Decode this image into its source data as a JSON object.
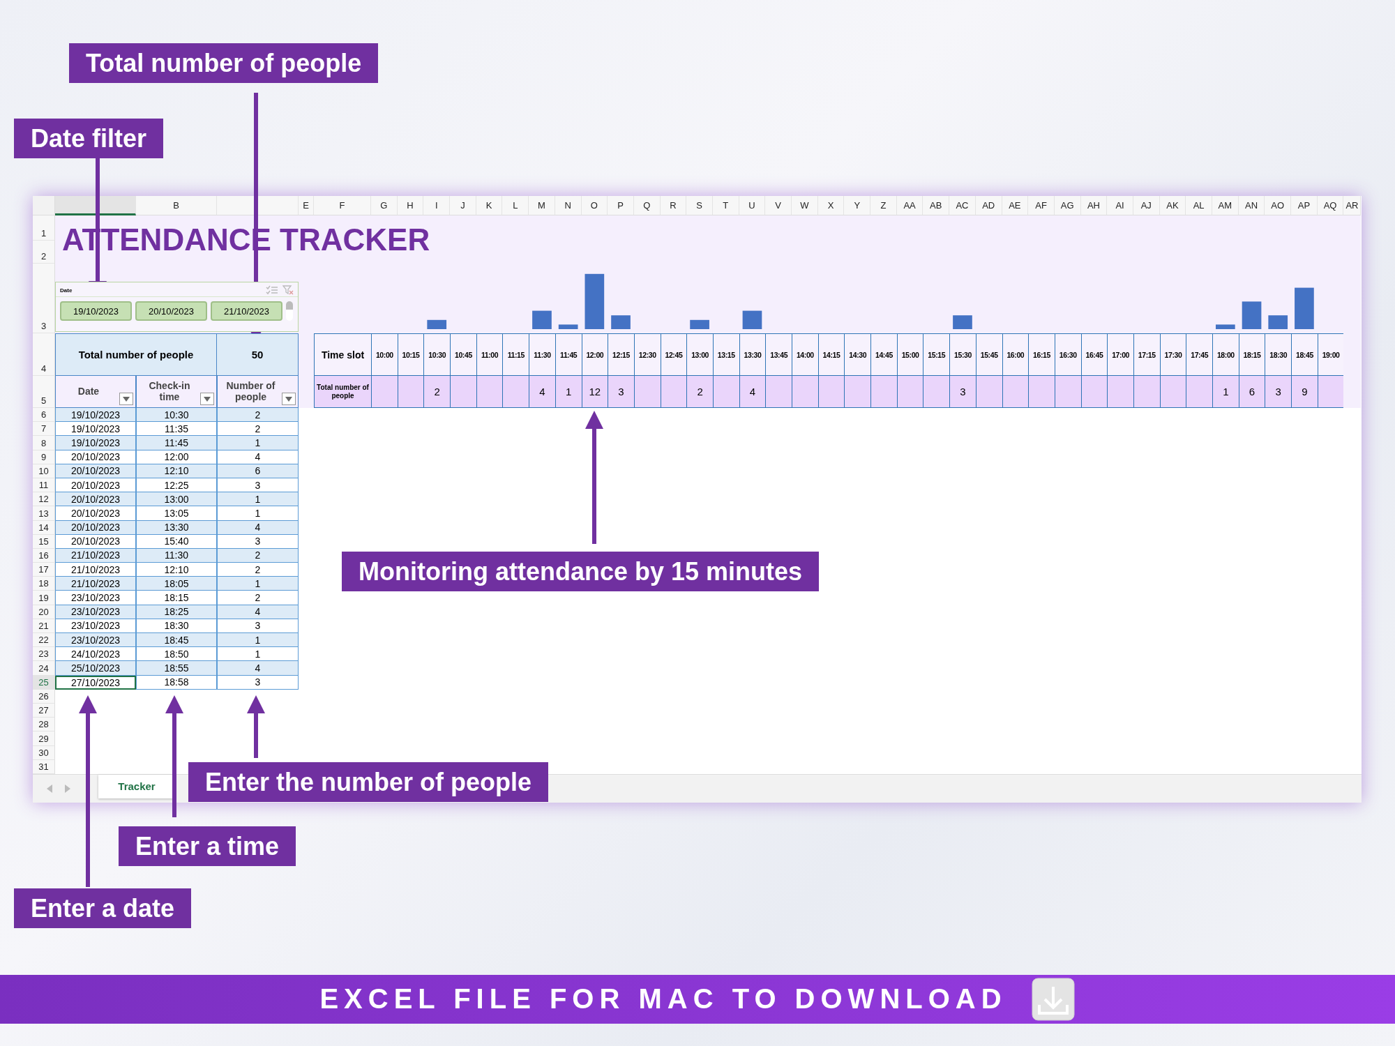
{
  "callouts": [
    {
      "text": "Total number of people"
    },
    {
      "text": "Date filter"
    },
    {
      "text": "Monitoring attendance by 15 minutes"
    },
    {
      "text": "Enter the number of people"
    },
    {
      "text": "Enter a time"
    },
    {
      "text": "Enter a date"
    }
  ],
  "spreadsheet": {
    "columns": [
      {
        "selected": true
      },
      {
        "label": "B",
        "selected": false
      },
      {
        "selected": false
      },
      {
        "label": "E",
        "selected": false
      },
      {
        "label": "F",
        "selected": false
      },
      {
        "label": "G",
        "selected": false
      },
      {
        "label": "H",
        "selected": false
      },
      {
        "label": "I",
        "selected": false
      },
      {
        "label": "J",
        "selected": false
      },
      {
        "label": "K",
        "selected": false
      },
      {
        "label": "L",
        "selected": false
      },
      {
        "label": "M",
        "selected": false
      },
      {
        "label": "N",
        "selected": false
      },
      {
        "label": "O",
        "selected": false
      },
      {
        "label": "P",
        "selected": false
      },
      {
        "label": "Q",
        "selected": false
      },
      {
        "label": "R",
        "selected": false
      },
      {
        "label": "S",
        "selected": false
      },
      {
        "label": "T",
        "selected": false
      },
      {
        "label": "U",
        "selected": false
      },
      {
        "label": "V",
        "selected": false
      },
      {
        "label": "W",
        "selected": false
      },
      {
        "label": "X",
        "selected": false
      },
      {
        "label": "Y",
        "selected": false
      },
      {
        "label": "Z",
        "selected": false
      },
      {
        "label": "AA",
        "selected": false
      },
      {
        "label": "AB",
        "selected": false
      },
      {
        "label": "AC",
        "selected": false
      },
      {
        "label": "AD",
        "selected": false
      },
      {
        "label": "AE",
        "selected": false
      },
      {
        "label": "AF",
        "selected": false
      },
      {
        "label": "AG",
        "selected": false
      },
      {
        "label": "AH",
        "selected": false
      },
      {
        "label": "AI",
        "selected": false
      },
      {
        "label": "AJ",
        "selected": false
      },
      {
        "label": "AK",
        "selected": false
      },
      {
        "label": "AL",
        "selected": false
      },
      {
        "label": "AM",
        "selected": false
      },
      {
        "label": "AN",
        "selected": false
      },
      {
        "label": "AO",
        "selected": false
      },
      {
        "label": "AP",
        "selected": false
      },
      {
        "label": "AQ",
        "selected": false
      },
      {
        "label": "AR",
        "selected": false
      }
    ],
    "row_numbers": [
      {
        "label": "1",
        "selected": false
      },
      {
        "label": "2",
        "selected": false
      },
      {
        "label": "3",
        "selected": false
      },
      {
        "label": "4",
        "selected": false
      },
      {
        "label": "5",
        "selected": false
      },
      {
        "label": "6",
        "selected": false
      },
      {
        "label": "7",
        "selected": false
      },
      {
        "label": "8",
        "selected": false
      },
      {
        "label": "9",
        "selected": false
      },
      {
        "label": "10",
        "selected": false
      },
      {
        "label": "11",
        "selected": false
      },
      {
        "label": "12",
        "selected": false
      },
      {
        "label": "13",
        "selected": false
      },
      {
        "label": "14",
        "selected": false
      },
      {
        "label": "15",
        "selected": false
      },
      {
        "label": "16",
        "selected": false
      },
      {
        "label": "17",
        "selected": false
      },
      {
        "label": "18",
        "selected": false
      },
      {
        "label": "19",
        "selected": false
      },
      {
        "label": "20",
        "selected": false
      },
      {
        "label": "21",
        "selected": false
      },
      {
        "label": "22",
        "selected": false
      },
      {
        "label": "23",
        "selected": false
      },
      {
        "label": "24",
        "selected": false
      },
      {
        "label": "25",
        "selected": true
      },
      {
        "label": "26",
        "selected": false
      },
      {
        "label": "27",
        "selected": false
      },
      {
        "label": "28",
        "selected": false
      },
      {
        "label": "29",
        "selected": false
      },
      {
        "label": "30",
        "selected": false
      },
      {
        "label": "31",
        "selected": false
      }
    ],
    "title": "ATTENDANCE TRACKER",
    "slicer": {
      "title": "Date",
      "items": [
        {
          "label": "19/10/2023",
          "selected": true
        },
        {
          "label": "20/10/2023",
          "selected": true
        },
        {
          "label": "21/10/2023",
          "selected": true
        }
      ]
    },
    "summary": {
      "label": "Total number of people",
      "value": "50"
    },
    "table": {
      "columns": [
        "Date",
        "Check-in time",
        "Number of people"
      ],
      "rows": [
        {
          "date": "19/10/2023",
          "time": "10:30",
          "people": "2",
          "selected": false
        },
        {
          "date": "19/10/2023",
          "time": "11:35",
          "people": "2",
          "selected": false
        },
        {
          "date": "19/10/2023",
          "time": "11:45",
          "people": "1",
          "selected": false
        },
        {
          "date": "20/10/2023",
          "time": "12:00",
          "people": "4",
          "selected": false
        },
        {
          "date": "20/10/2023",
          "time": "12:10",
          "people": "6",
          "selected": false
        },
        {
          "date": "20/10/2023",
          "time": "12:25",
          "people": "3",
          "selected": false
        },
        {
          "date": "20/10/2023",
          "time": "13:00",
          "people": "1",
          "selected": false
        },
        {
          "date": "20/10/2023",
          "time": "13:05",
          "people": "1",
          "selected": false
        },
        {
          "date": "20/10/2023",
          "time": "13:30",
          "people": "4",
          "selected": false
        },
        {
          "date": "20/10/2023",
          "time": "15:40",
          "people": "3",
          "selected": false
        },
        {
          "date": "21/10/2023",
          "time": "11:30",
          "people": "2",
          "selected": false
        },
        {
          "date": "21/10/2023",
          "time": "12:10",
          "people": "2",
          "selected": false
        },
        {
          "date": "21/10/2023",
          "time": "18:05",
          "people": "1",
          "selected": false
        },
        {
          "date": "23/10/2023",
          "time": "18:15",
          "people": "2",
          "selected": false
        },
        {
          "date": "23/10/2023",
          "time": "18:25",
          "people": "4",
          "selected": false
        },
        {
          "date": "23/10/2023",
          "time": "18:30",
          "people": "3",
          "selected": false
        },
        {
          "date": "23/10/2023",
          "time": "18:45",
          "people": "1",
          "selected": false
        },
        {
          "date": "24/10/2023",
          "time": "18:50",
          "people": "1",
          "selected": false
        },
        {
          "date": "25/10/2023",
          "time": "18:55",
          "people": "4",
          "selected": false
        },
        {
          "date": "27/10/2023",
          "time": "18:58",
          "people": "3",
          "selected": true
        }
      ]
    },
    "time_slots": {
      "label": "Time slot",
      "total_label": "Total number of people",
      "slots": [
        {
          "time": "10:00"
        },
        {
          "time": "10:15"
        },
        {
          "time": "10:30",
          "total": "2"
        },
        {
          "time": "10:45"
        },
        {
          "time": "11:00"
        },
        {
          "time": "11:15"
        },
        {
          "time": "11:30",
          "total": "4"
        },
        {
          "time": "11:45",
          "total": "1"
        },
        {
          "time": "12:00",
          "total": "12"
        },
        {
          "time": "12:15",
          "total": "3"
        },
        {
          "time": "12:30"
        },
        {
          "time": "12:45"
        },
        {
          "time": "13:00",
          "total": "2"
        },
        {
          "time": "13:15"
        },
        {
          "time": "13:30",
          "total": "4"
        },
        {
          "time": "13:45"
        },
        {
          "time": "14:00"
        },
        {
          "time": "14:15"
        },
        {
          "time": "14:30"
        },
        {
          "time": "14:45"
        },
        {
          "time": "15:00"
        },
        {
          "time": "15:15"
        },
        {
          "time": "15:30",
          "total": "3"
        },
        {
          "time": "15:45"
        },
        {
          "time": "16:00"
        },
        {
          "time": "16:15"
        },
        {
          "time": "16:30"
        },
        {
          "time": "16:45"
        },
        {
          "time": "17:00"
        },
        {
          "time": "17:15"
        },
        {
          "time": "17:30"
        },
        {
          "time": "17:45"
        },
        {
          "time": "18:00",
          "total": "1"
        },
        {
          "time": "18:15",
          "total": "6"
        },
        {
          "time": "18:30",
          "total": "3"
        },
        {
          "time": "18:45",
          "total": "9"
        },
        {
          "time": "19:00"
        }
      ]
    },
    "sheet_tabs": [
      {
        "label": "Tracker",
        "selected": true
      }
    ]
  },
  "footer": {
    "text": "EXCEL FILE FOR MAC TO DOWNLOAD"
  }
}
